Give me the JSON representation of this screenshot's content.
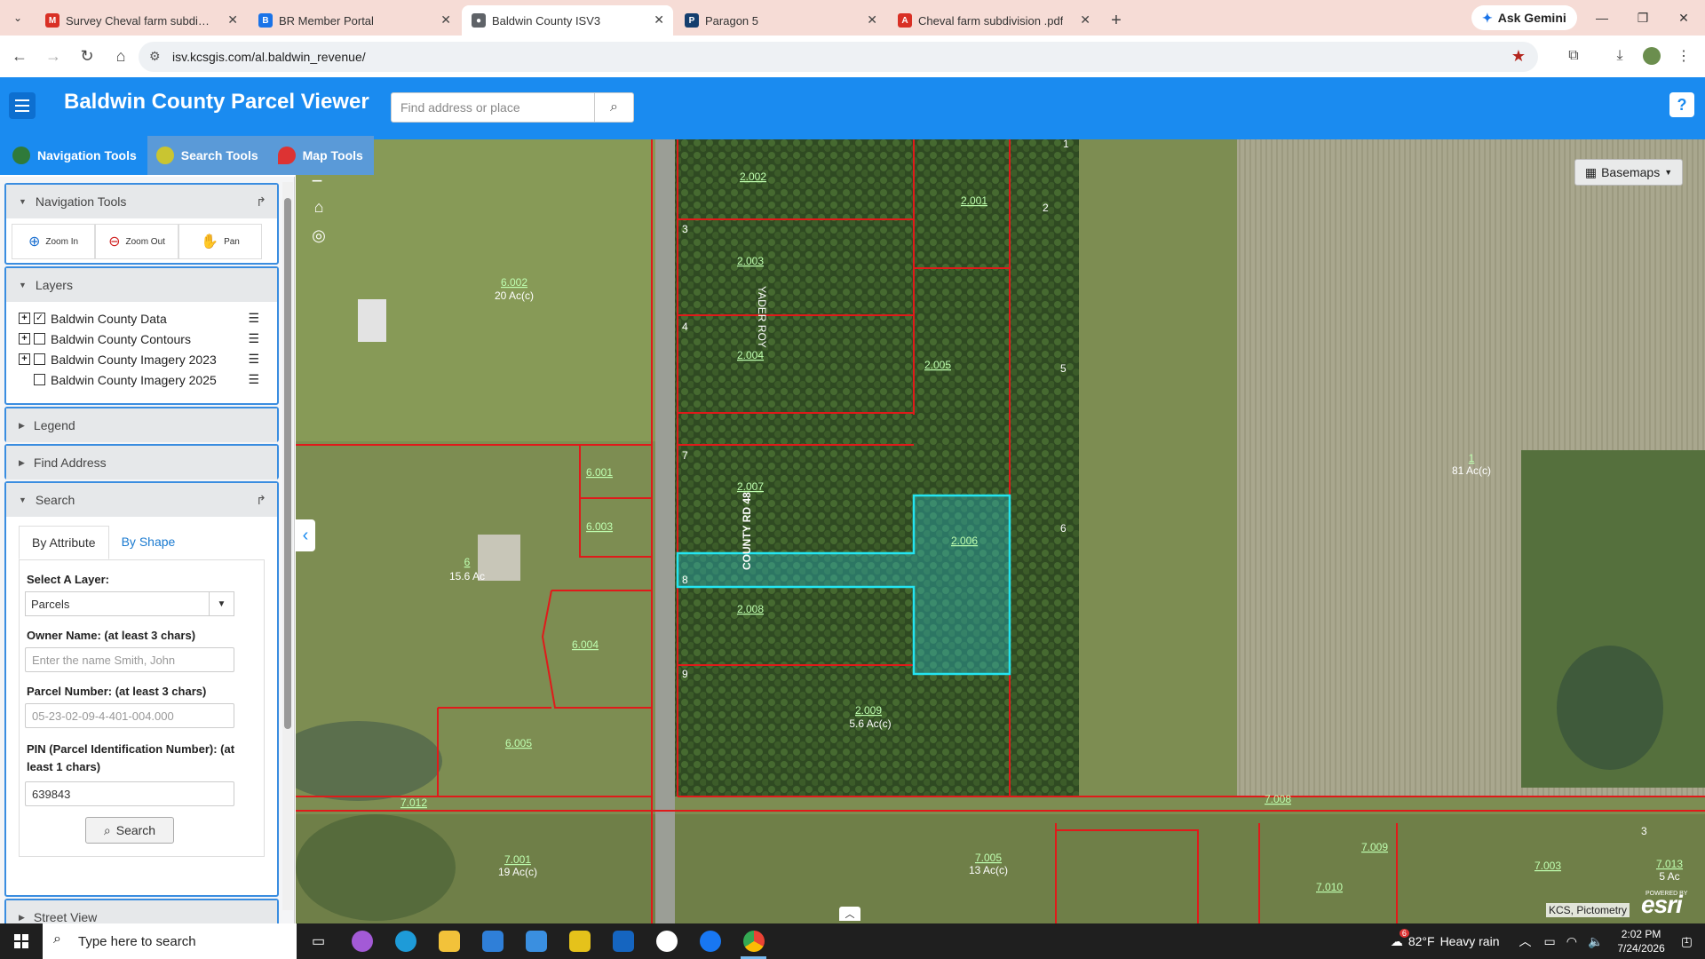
{
  "browser": {
    "tabs": [
      {
        "title": "Survey Cheval farm subdivision",
        "icon": "gmail-icon",
        "color": "#d93025"
      },
      {
        "title": "BR Member Portal",
        "icon": "portal-icon",
        "color": "#1a73e8"
      },
      {
        "title": "Baldwin County ISV3",
        "icon": "globe-icon",
        "color": "#5f6368"
      },
      {
        "title": "Paragon 5",
        "icon": "paragon-icon",
        "color": "#143e6e"
      },
      {
        "title": "Cheval farm subdivision .pdf",
        "icon": "pdf-icon",
        "color": "#d93025"
      }
    ],
    "active_tab": 2,
    "ask_gemini": "Ask Gemini",
    "url": "isv.kcsgis.com/al.baldwin_revenue/"
  },
  "app": {
    "title": "Baldwin County Parcel Viewer",
    "search_placeholder": "Find address or place",
    "help": "?",
    "accent": "#1a8bf0"
  },
  "tool_tabs": [
    {
      "label": "Navigation Tools",
      "active": true
    },
    {
      "label": "Search Tools",
      "active": false
    },
    {
      "label": "Map Tools",
      "active": false
    }
  ],
  "panel": {
    "navigation": {
      "title": "Navigation Tools",
      "buttons": [
        "Zoom In",
        "Zoom Out",
        "Pan"
      ]
    },
    "layers": {
      "title": "Layers",
      "items": [
        {
          "label": "Baldwin County Data",
          "checked": true,
          "expandable": true
        },
        {
          "label": "Baldwin County Contours",
          "checked": false,
          "expandable": true
        },
        {
          "label": "Baldwin County Imagery 2023",
          "checked": false,
          "expandable": true
        },
        {
          "label": "Baldwin County Imagery 2025",
          "checked": false,
          "expandable": false
        }
      ]
    },
    "legend": "Legend",
    "find_address": "Find Address",
    "search": {
      "title": "Search",
      "tab_attribute": "By Attribute",
      "tab_shape": "By Shape",
      "layer_label": "Select A Layer:",
      "layer_value": "Parcels",
      "owner_label": "Owner Name: (at least 3 chars)",
      "owner_placeholder": "Enter the name Smith, John",
      "parcel_label": "Parcel Number: (at least 3 chars)",
      "parcel_placeholder": "05-23-02-09-4-401-004.000",
      "pin_label": "PIN (Parcel Identification Number): (at least 1 chars)",
      "pin_value": "639843",
      "button": "Search"
    },
    "street_view": "Street View"
  },
  "map": {
    "basemaps": "Basemaps",
    "road_label": "COUNTY RD 48",
    "road_label_2": "YADER ROY",
    "attribution": "KCS, Pictometry",
    "esri": "esri",
    "powered_by": "POWERED BY",
    "parcel_labels": [
      "2.002",
      "2.001",
      "2.003",
      "2.004",
      "2.005",
      "2.007",
      "2.006",
      "2.008",
      "2.009",
      "5.6 Ac(c)",
      "6.002",
      "20 Ac(c)",
      "6.001",
      "6.003",
      "6",
      "15.6 Ac",
      "6.004",
      "6.005",
      "1",
      "81 Ac(c)",
      "7.012",
      "7.008",
      "7.001",
      "19 Ac(c)",
      "7.005",
      "13 Ac(c)",
      "7.009",
      "7.010",
      "7.003",
      "7.013",
      "5 Ac",
      "1",
      "2",
      "3",
      "4",
      "5",
      "7",
      "6",
      "8",
      "9",
      "3"
    ]
  },
  "taskbar": {
    "search_placeholder": "Type here to search",
    "weather_temp": "82°F",
    "weather_desc": "Heavy rain",
    "weather_badge": "6",
    "time": "2:02 PM",
    "date": "7/24/2026",
    "notifications": "1"
  }
}
